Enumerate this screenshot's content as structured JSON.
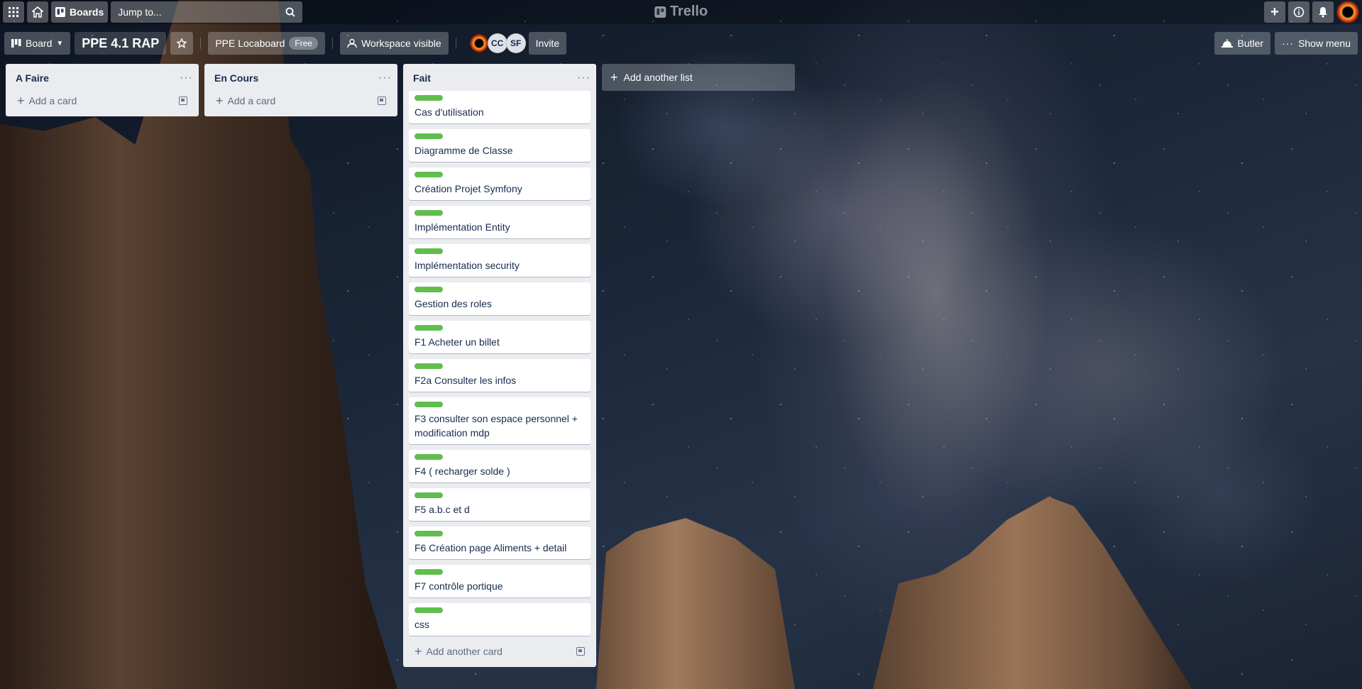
{
  "topbar": {
    "boards_label": "Boards",
    "search_placeholder": "Jump to...",
    "logo_text": "Trello"
  },
  "board": {
    "view_label": "Board",
    "title": "PPE 4.1 RAP",
    "workspace_name": "PPE Locaboard",
    "workspace_plan": "Free",
    "visibility_label": "Workspace visible",
    "members": [
      "CC",
      "SF"
    ],
    "invite_label": "Invite",
    "butler_label": "Butler",
    "show_menu_label": "Show menu"
  },
  "lists": [
    {
      "title": "A Faire",
      "add_label": "Add a card",
      "cards": []
    },
    {
      "title": "En Cours",
      "add_label": "Add a card",
      "cards": []
    },
    {
      "title": "Fait",
      "add_label": "Add another card",
      "cards": [
        "Cas d'utilisation",
        "Diagramme de Classe",
        "Création Projet Symfony",
        "Implémentation Entity",
        "Implémentation security",
        "Gestion des roles",
        "F1 Acheter un billet",
        "F2a Consulter les infos",
        "F3 consulter son espace personnel + modification mdp",
        "F4 ( recharger solde )",
        "F5 a.b.c et d",
        "F6 Création page Aliments + detail",
        "F7 contrôle portique",
        "css"
      ]
    }
  ],
  "add_list_label": "Add another list",
  "colors": {
    "label_green": "#61bd4f",
    "list_bg": "#ebecf0"
  }
}
